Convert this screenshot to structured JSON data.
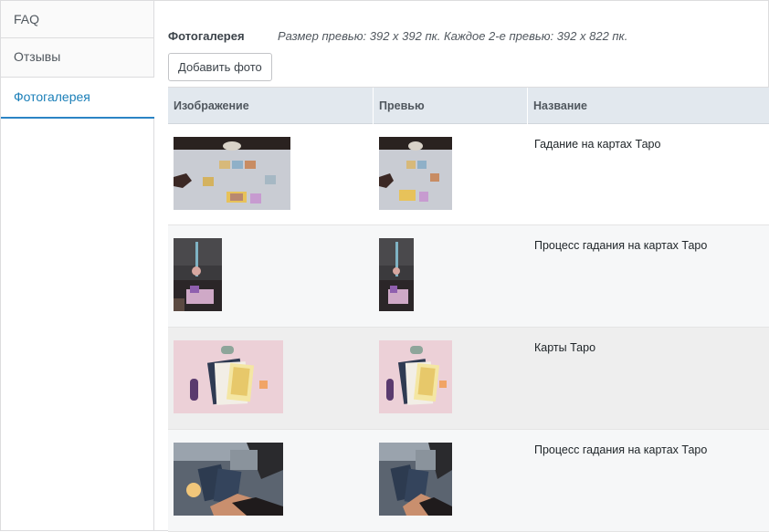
{
  "sidebar": {
    "tabs": [
      {
        "label": "FAQ",
        "active": false
      },
      {
        "label": "Отзывы",
        "active": false
      },
      {
        "label": "Фотогалерея",
        "active": true
      }
    ]
  },
  "gallery": {
    "title": "Фотогалерея",
    "note": "Размер превью: 392 x 392 пк. Каждое 2-е превью: 392 x 822 пк.",
    "add_button": "Добавить фото",
    "columns": [
      "Изображение",
      "Превью",
      "Название"
    ],
    "rows": [
      {
        "name": "Гадание на картах Таро",
        "image": "tarot-cards-on-tablecloth-photo"
      },
      {
        "name": "Процесс гадания на картах Таро",
        "image": "tarot-reading-candles-photo"
      },
      {
        "name": "Карты Таро",
        "image": "tarot-cards-pink-background-photo"
      },
      {
        "name": "Процесс гадания на картах Таро",
        "image": "tarot-hands-cards-photo"
      }
    ]
  },
  "colors": {
    "accent": "#1b7fb8",
    "header_bg": "#e2e8ee",
    "row_alt": "#f6f7f8"
  }
}
